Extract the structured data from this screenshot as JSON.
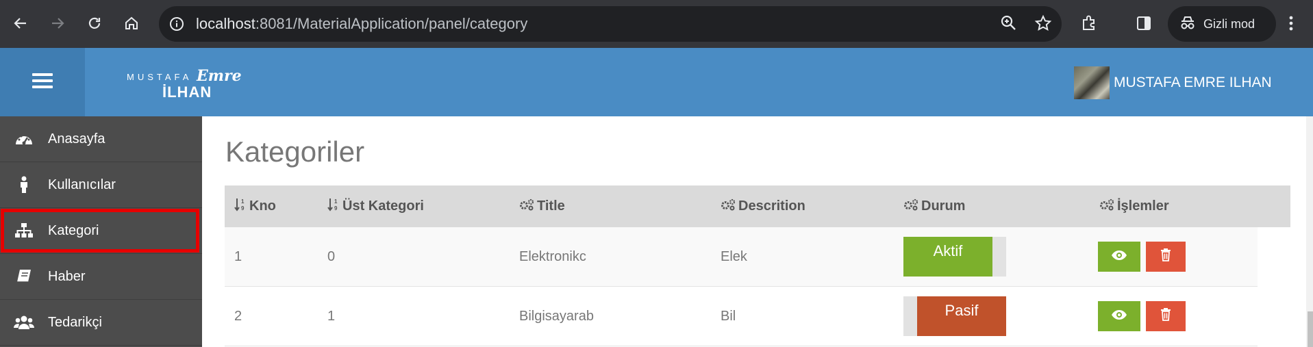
{
  "browser": {
    "url_host": "localhost",
    "url_path": ":8081/MaterialApplication/panel/category",
    "incognito_label": "Gizli mod"
  },
  "header": {
    "logo_top": "MUSTAFA",
    "logo_script": "Emre",
    "logo_bottom": "İLHAN",
    "user_name": "MUSTAFA EMRE ILHAN"
  },
  "sidebar": {
    "items": [
      {
        "label": "Anasayfa",
        "icon": "dashboard-icon"
      },
      {
        "label": "Kullanıcılar",
        "icon": "user-icon"
      },
      {
        "label": "Kategori",
        "icon": "sitemap-icon"
      },
      {
        "label": "Haber",
        "icon": "book-icon"
      },
      {
        "label": "Tedarikçi",
        "icon": "users-icon"
      }
    ]
  },
  "main": {
    "title": "Kategoriler",
    "columns": [
      "Kno",
      "Üst Kategori",
      "Title",
      "Descrition",
      "Durum",
      "İşlemler"
    ],
    "rows": [
      {
        "kno": "1",
        "parent": "0",
        "title": "Elektronikc",
        "desc": "Elek",
        "status": "Aktif"
      },
      {
        "kno": "2",
        "parent": "1",
        "title": "Bilgisayarab",
        "desc": "Bil",
        "status": "Pasif"
      }
    ]
  },
  "colors": {
    "header_blue": "#4a8cc4",
    "sidebar_gray": "#4c4c4c",
    "active_green": "#7cb02c",
    "passive_red": "#c0522b",
    "delete_red": "#e0543a",
    "highlight_red": "#e60000"
  }
}
